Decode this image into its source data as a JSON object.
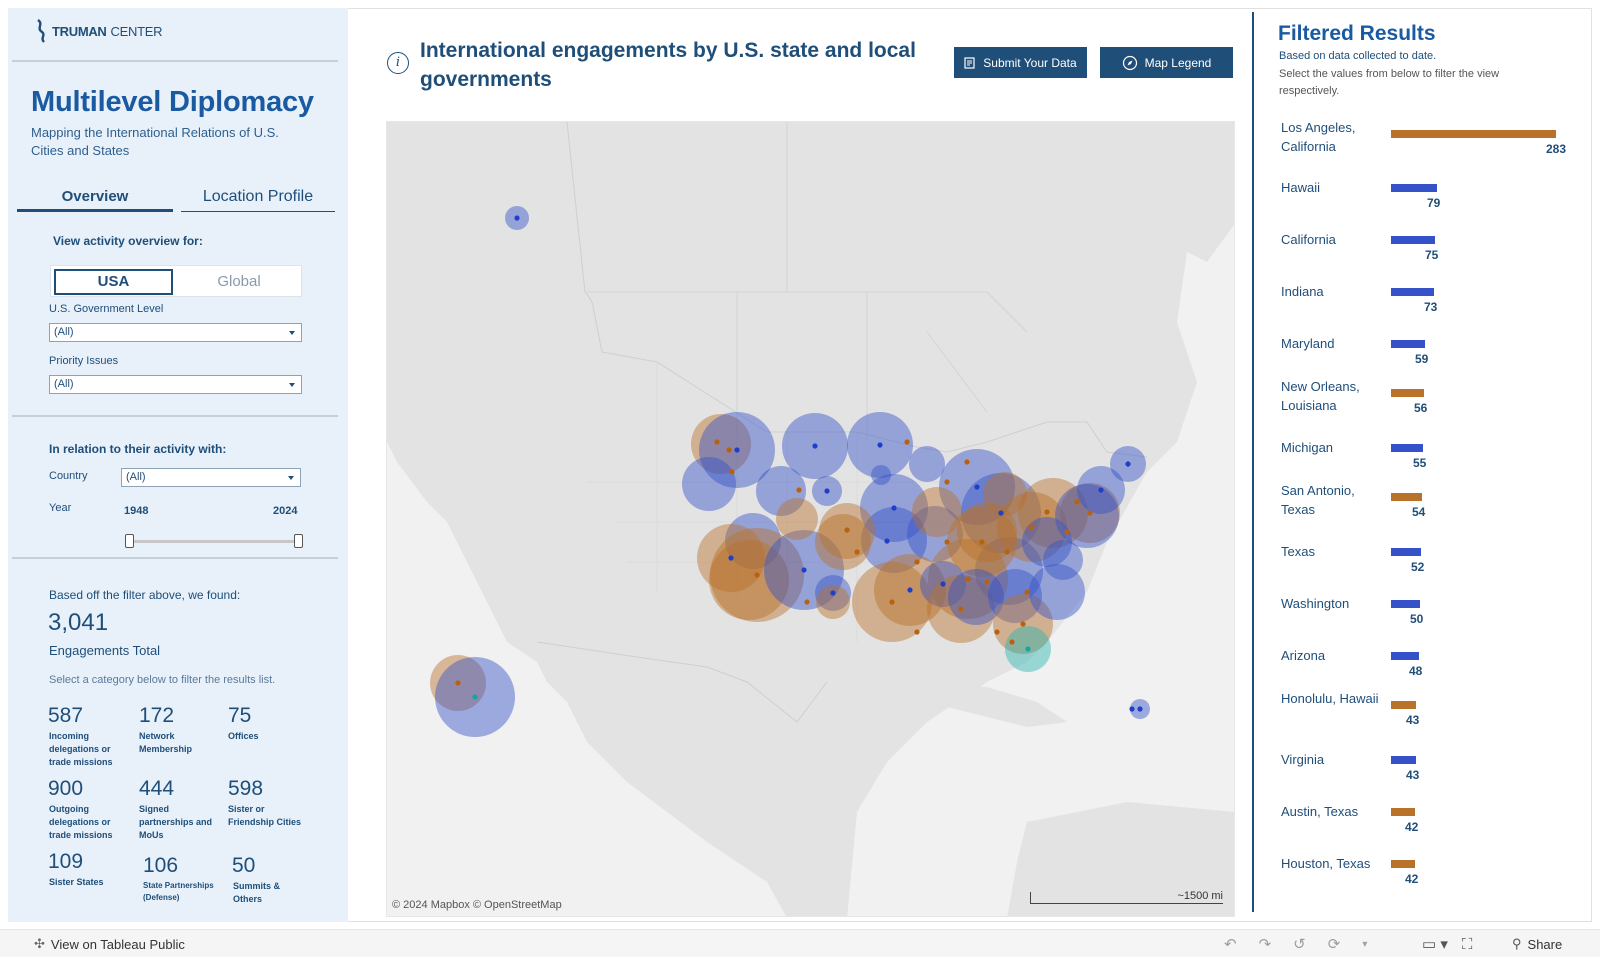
{
  "brand": {
    "name_bold": "TRUMAN",
    "name_light": "CENTER"
  },
  "sidebar": {
    "title": "Multilevel Diplomacy",
    "subtitle": "Mapping the International Relations of U.S. Cities and States",
    "tabs": [
      {
        "label": "Overview",
        "active": true
      },
      {
        "label": "Location Profile",
        "active": false
      }
    ],
    "view_label": "View activity overview for:",
    "toggle": {
      "usa": "USA",
      "global": "Global",
      "selected": "USA"
    },
    "gov_level": {
      "label": "U.S. Government Level",
      "value": "(All)"
    },
    "priority": {
      "label": "Priority Issues",
      "value": "(All)"
    },
    "relation_label": "In relation to their activity with:",
    "country": {
      "label": "Country",
      "value": "(All)"
    },
    "year": {
      "label": "Year",
      "min": "1948",
      "max": "2024"
    },
    "found_label": "Based off the filter above, we found:",
    "total": "3,041",
    "total_label": "Engagements Total",
    "category_hint": "Select a category below to filter the results list.",
    "categories": [
      {
        "value": "587",
        "label": "Incoming delegations or trade missions"
      },
      {
        "value": "172",
        "label": "Network Membership"
      },
      {
        "value": "75",
        "label": "Offices"
      },
      {
        "value": "900",
        "label": "Outgoing delegations or trade missions"
      },
      {
        "value": "444",
        "label": "Signed partnerships and MoUs"
      },
      {
        "value": "598",
        "label": "Sister or Friendship Cities"
      },
      {
        "value": "109",
        "label": "Sister States"
      },
      {
        "value": "106",
        "label": "State Partnerships (Defense)"
      },
      {
        "value": "50",
        "label": "Summits & Others"
      }
    ]
  },
  "header": {
    "title": "International engagements by U.S. state and local governments",
    "submit_label": "Submit Your Data",
    "legend_label": "Map Legend"
  },
  "map": {
    "attribution": "© 2024 Mapbox  © OpenStreetMap",
    "scale_label": "~1500 mi"
  },
  "results": {
    "title": "Filtered Results",
    "subtitle": "Based on data collected to date.",
    "hint": "Select the values from below to filter the view respectively.",
    "max": 283,
    "items": [
      {
        "name": "Los Angeles, California",
        "value": 283,
        "kind": "city"
      },
      {
        "name": "Hawaii",
        "value": 79,
        "kind": "state"
      },
      {
        "name": "California",
        "value": 75,
        "kind": "state"
      },
      {
        "name": "Indiana",
        "value": 73,
        "kind": "state"
      },
      {
        "name": "Maryland",
        "value": 59,
        "kind": "state"
      },
      {
        "name": "New Orleans, Louisiana",
        "value": 56,
        "kind": "city"
      },
      {
        "name": "Michigan",
        "value": 55,
        "kind": "state"
      },
      {
        "name": "San Antonio, Texas",
        "value": 54,
        "kind": "city"
      },
      {
        "name": "Texas",
        "value": 52,
        "kind": "state"
      },
      {
        "name": "Washington",
        "value": 50,
        "kind": "state"
      },
      {
        "name": "Arizona",
        "value": 48,
        "kind": "state"
      },
      {
        "name": "Honolulu, Hawaii",
        "value": 43,
        "kind": "city"
      },
      {
        "name": "Virginia",
        "value": 43,
        "kind": "state"
      },
      {
        "name": "Austin, Texas",
        "value": 42,
        "kind": "city"
      },
      {
        "name": "Houston, Texas",
        "value": 42,
        "kind": "city"
      }
    ]
  },
  "colors": {
    "state": "#3552c8",
    "city": "#b8722a",
    "accent": "#1f4e79",
    "teal": "#2ab5b0"
  },
  "footer": {
    "tableau_link": "View on Tableau Public",
    "share": "Share"
  }
}
